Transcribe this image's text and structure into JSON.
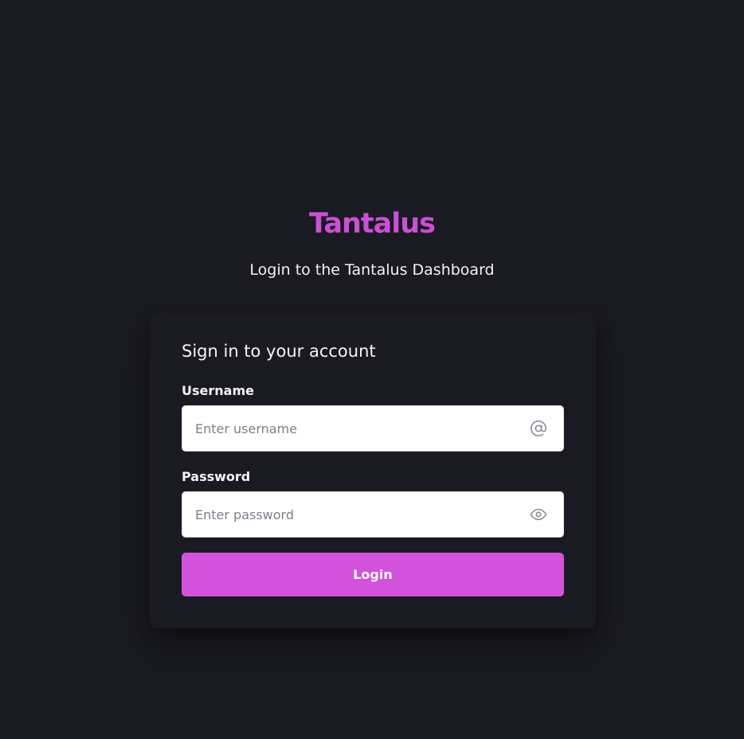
{
  "header": {
    "brand": "Tantalus",
    "subtitle": "Login to the Tantalus Dashboard"
  },
  "form": {
    "title": "Sign in to your account",
    "username": {
      "label": "Username",
      "value": "",
      "placeholder": "Enter username",
      "icon": "at-sign-icon"
    },
    "password": {
      "label": "Password",
      "value": "",
      "placeholder": "Enter password",
      "icon": "eye-icon"
    },
    "submit_label": "Login"
  },
  "colors": {
    "background": "#1a1a22",
    "accent": "#d352db",
    "brand": "#cc4fd6",
    "text": "#f4f4f7",
    "icon": "#8a8e98"
  }
}
